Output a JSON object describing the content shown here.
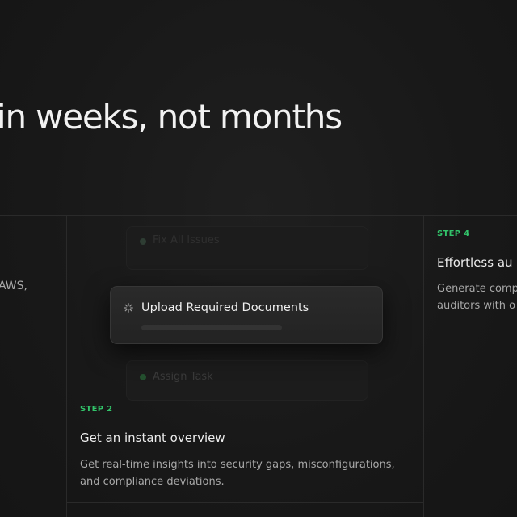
{
  "hero": {
    "headline": "in weeks, not months"
  },
  "left_column": {
    "cut_text": "AWS,"
  },
  "step2": {
    "label": "STEP 2",
    "title": "Get an instant overview",
    "desc_line1": "Get real-time insights into security gaps, misconfigurations,",
    "desc_line2": "and compliance deviations."
  },
  "step4": {
    "label": "STEP 4",
    "title": "Effortless au",
    "desc_line1": "Generate comp",
    "desc_line2": "auditors with o"
  },
  "task_cards": {
    "top_ghost": "Fix All Issues",
    "main": "Upload Required Documents",
    "main_progress": 0,
    "bottom_ghost": "Assign Task"
  },
  "colors": {
    "accent_green": "#32c46a",
    "background": "#181818"
  }
}
